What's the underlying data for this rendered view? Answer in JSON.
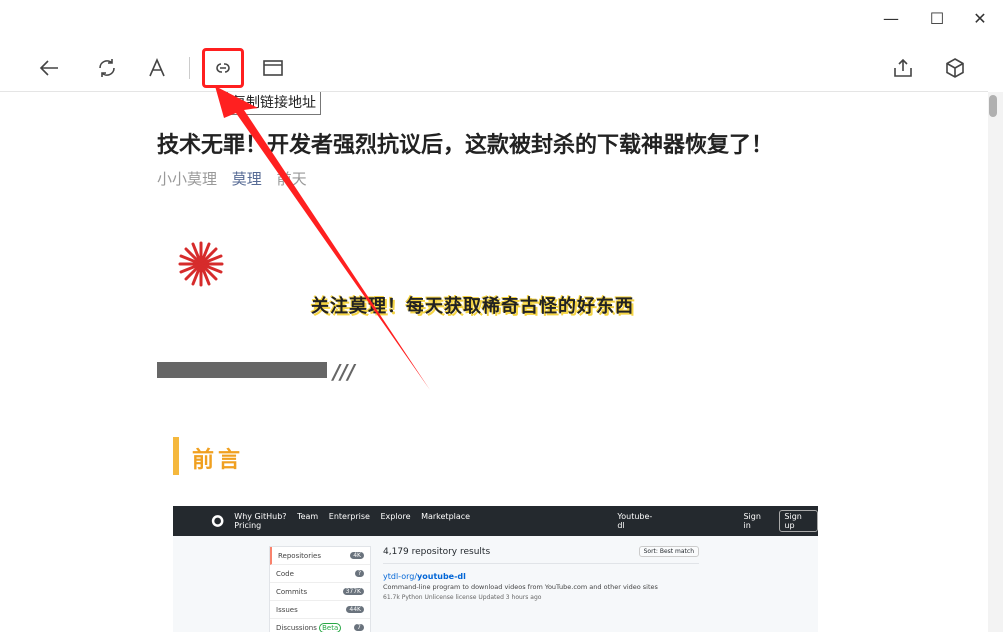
{
  "window": {
    "controls": {
      "minimize": "—",
      "maximize": "☐",
      "close": "✕"
    }
  },
  "toolbar": {
    "tooltip": "复制链接地址",
    "icons": [
      "back-arrow-icon",
      "refresh-icon",
      "font-icon",
      "link-icon",
      "window-icon",
      "share-icon",
      "cube-icon"
    ],
    "accent_highlight": "#ff1f1f"
  },
  "article": {
    "title": "技术无罪！开发者强烈抗议后，这款被封杀的下载神器恢复了！",
    "author": "小小莫理",
    "account": "莫理",
    "time": "前天",
    "banner": "关注莫理！每天获取稀奇古怪的好东西",
    "section_title": "前言"
  },
  "github": {
    "nav": [
      "Why GitHub?",
      "Team",
      "Enterprise",
      "Explore",
      "Marketplace",
      "Pricing"
    ],
    "search": "Youtube-dl",
    "signin": "Sign in",
    "signup": "Sign up",
    "sidebar": [
      {
        "label": "Repositories",
        "count": "4K"
      },
      {
        "label": "Code",
        "count": "?"
      },
      {
        "label": "Commits",
        "count": "377K"
      },
      {
        "label": "Issues",
        "count": "44K"
      },
      {
        "label": "Discussions",
        "count": "7"
      }
    ],
    "discussions_tag": "Beta",
    "results": "4,179 repository results",
    "sort": "Sort: Best match",
    "repo_owner": "ytdl-org/",
    "repo_name": "youtube-dl",
    "repo_desc": "Command-line program to download videos from YouTube.com and other video sites",
    "repo_meta": "61.7k   Python   Unlicense license   Updated 3 hours ago"
  }
}
